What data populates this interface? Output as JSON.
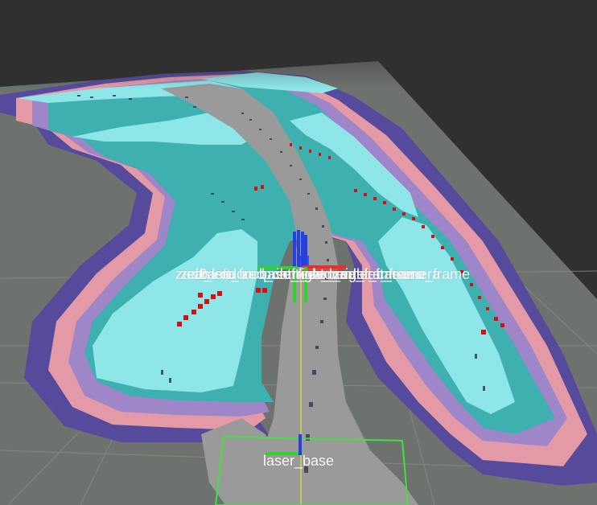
{
  "app": {
    "name": "RViz 3D view"
  },
  "colors": {
    "background": "#303030",
    "ground_plane": "#6e726f",
    "grid_line": "#8a8a8a",
    "costmap_free": "#9a9a9a",
    "costmap_cyan": "#8ee6e8",
    "costmap_teal": "#3fb0b0",
    "costmap_purple": "#9f86c8",
    "costmap_pink": "#e39aa6",
    "costmap_violet": "#564a9c",
    "obstacle_red": "#d41010",
    "axis_x": "#e53030",
    "axis_y": "#2fd02f",
    "axis_z": "#2640e0",
    "path_line": "#c8c45a",
    "footprint": "#40e040"
  },
  "tf_frames": {
    "overlapping_labels": [
      "zed2",
      "zed_left",
      "camera",
      "base_footprint",
      "odom",
      "zed_camera_center",
      "base_link",
      "left_camera_frame",
      "right_camera_frame",
      "zed_right_camera_frame",
      "zed_left_camera"
    ],
    "laser_base": "laser_base"
  },
  "icons": [
    "tf-axes-icon",
    "robot-footprint-icon"
  ]
}
